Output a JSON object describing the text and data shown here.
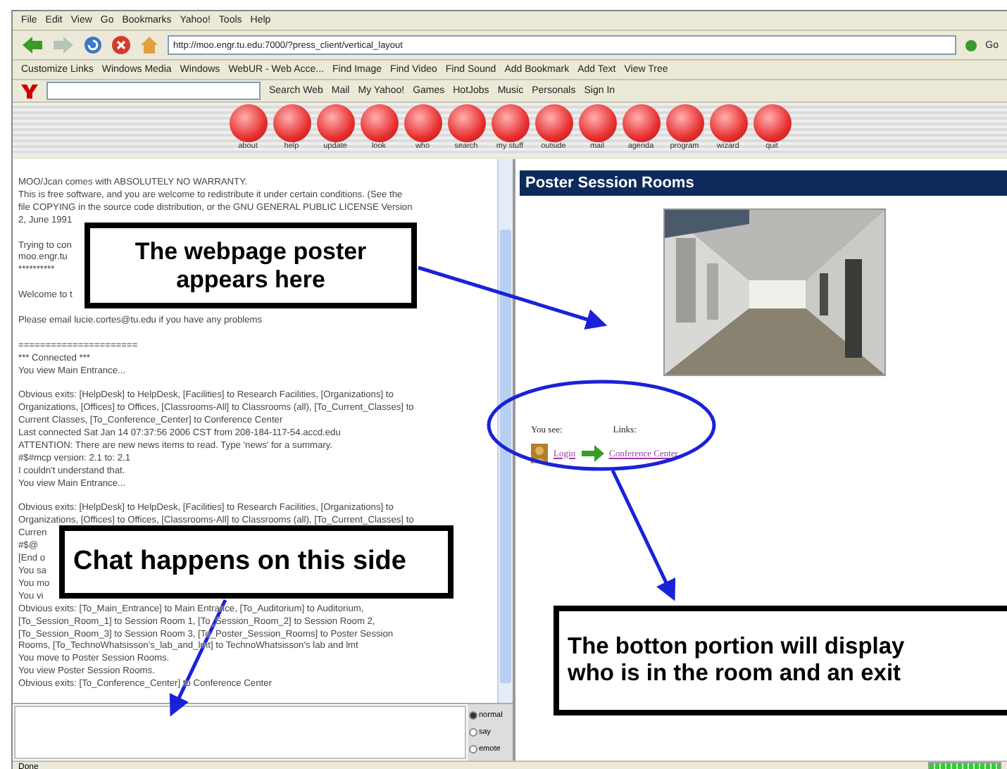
{
  "menu": [
    "File",
    "Edit",
    "View",
    "Go",
    "Bookmarks",
    "Yahoo!",
    "Tools",
    "Help"
  ],
  "address_bar": {
    "url": "http://moo.engr.tu.edu:7000/?press_client/vertical_layout",
    "go_label": "Go"
  },
  "bookmarks": [
    "Customize Links",
    "Windows Media",
    "Windows",
    "WebUR - Web Acce...",
    "Find Image",
    "Find Video",
    "Find Sound",
    "Add Bookmark",
    "Add Text",
    "View Tree"
  ],
  "yahoo_toolbar": [
    "Search Web",
    "Mail",
    "My Yahoo!",
    "Games",
    "HotJobs",
    "Music",
    "Personals",
    "Sign In"
  ],
  "command_buttons": [
    "about",
    "help",
    "update",
    "look",
    "who",
    "search",
    "my stuff",
    "outside",
    "mail",
    "agenda",
    "program",
    "wizard",
    "quit"
  ],
  "chat": {
    "lines": [
      {
        "text": "MOO/Jcan comes with ABSOLUTELY NO WARRANTY."
      },
      {
        "text": "This is free software, and you are welcome to redistribute it under certain conditions. (See the"
      },
      {
        "text": "file COPYING in the source code distribution, or the GNU GENERAL PUBLIC LICENSE Version"
      },
      {
        "text": "2, June 1991"
      },
      {
        "text": "Trying to con",
        "break_before": true
      },
      {
        "text": "moo.engr.tu"
      },
      {
        "text": "**********"
      },
      {
        "text": "Welcome to t",
        "break_before": true
      },
      {
        "text": "Please email lucie.cortes@tu.edu if you have any problems",
        "break_before": true
      },
      {
        "text": "======================",
        "break_before": true
      },
      {
        "text": "*** Connected ***"
      },
      {
        "text": "You view Main Entrance..."
      },
      {
        "text": "Obvious exits: [HelpDesk] to HelpDesk, [Facilities] to Research Facilities, [Organizations] to",
        "break_before": true
      },
      {
        "text": "Organizations, [Offices] to Offices, [Classrooms-All] to Classrooms (all), [To_Current_Classes] to"
      },
      {
        "text": "Current Classes, [To_Conference_Center] to Conference Center"
      },
      {
        "text": "Last connected Sat Jan 14 07:37:56 2006 CST from 208-184-117-54.accd.edu"
      },
      {
        "text": "ATTENTION:  There are new news items to read.  Type 'news' for a summary."
      },
      {
        "text": "#$#mcp version: 2.1 to: 2.1"
      },
      {
        "text": "I couldn't understand that."
      },
      {
        "text": "You view Main Entrance..."
      },
      {
        "text": "Obvious exits: [HelpDesk] to HelpDesk, [Facilities] to Research Facilities, [Organizations] to",
        "break_before": true
      },
      {
        "text": "Organizations, [Offices] to Offices, [Classrooms-All] to Classrooms (all), [To_Current_Classes] to"
      },
      {
        "text": "Curren"
      },
      {
        "text": "#$@"
      },
      {
        "text": "[End o"
      },
      {
        "text": "You sa"
      },
      {
        "text": "You mo"
      },
      {
        "text": "You vi"
      },
      {
        "text": "Obvious exits: [To_Main_Entrance] to Main Entrance, [To_Auditorium] to Auditorium,"
      },
      {
        "text": "[To_Session_Room_1] to Session Room 1, [To_Session_Room_2] to Session Room 2,"
      },
      {
        "text": "[To_Session_Room_3] to Session Room 3, [To_Poster_Session_Rooms] to Poster Session"
      },
      {
        "text": "Rooms, [To_TechnoWhatsisson's_lab_and_lmt] to TechnoWhatsisson's lab and lmt"
      },
      {
        "text": "You move to Poster Session Rooms."
      },
      {
        "text": "You view Poster Session Rooms."
      },
      {
        "text": "Obvious exits: [To_Conference_Center] to Conference Center"
      }
    ],
    "modes": [
      {
        "label": "normal",
        "selected": true
      },
      {
        "label": "say",
        "selected": false
      },
      {
        "label": "emote",
        "selected": false
      }
    ]
  },
  "room": {
    "title": "Poster Session Rooms",
    "you_see_label": "You see:",
    "links_label": "Links:",
    "people": [
      "Login"
    ],
    "exits": [
      "Conference Center"
    ]
  },
  "status_bar": {
    "text": "Done",
    "progress": {
      "level": 1
    }
  },
  "annotations": [
    "The webpage poster appears here",
    "Chat happens on this side",
    "The botton portion will display who is in the room and an exit"
  ]
}
